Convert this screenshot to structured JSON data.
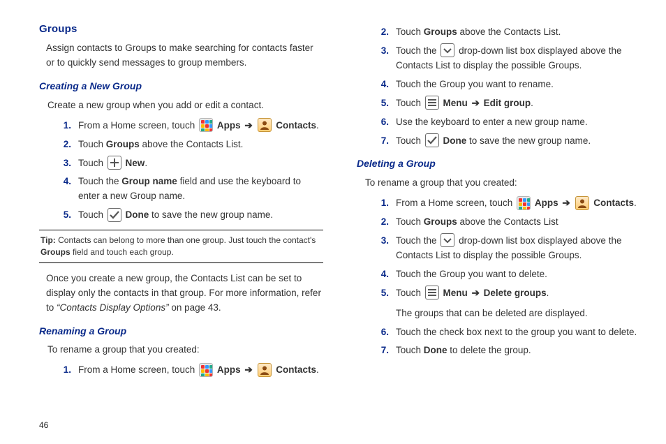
{
  "pageNumber": "46",
  "left": {
    "h1": "Groups",
    "intro": "Assign contacts to Groups to make searching for contacts faster or to quickly send messages to group members.",
    "h2a": "Creating a New Group",
    "createIntro": "Create a new group when you add or edit a contact.",
    "steps1": {
      "s1a": "From a Home screen, touch ",
      "s1apps": "Apps",
      "s1arrow": "➔",
      "s1contacts": "Contacts",
      "s1end": ".",
      "s2a": "Touch ",
      "s2b": "Groups",
      "s2c": " above the Contacts List.",
      "s3a": "Touch ",
      "s3b": "New",
      "s3c": ".",
      "s4a": "Touch the ",
      "s4b": "Group name",
      "s4c": " field",
      "s4d": " and use the keyboard to enter a new Group name.",
      "s5a": "Touch ",
      "s5b": "Done",
      "s5c": " to save the new group name."
    },
    "tip": {
      "label": "Tip:",
      "textA": " Contacts can belong to more than one group. Just touch the contact's ",
      "bold": "Groups",
      "textB": " field and touch each group."
    },
    "afterTip": {
      "lineA": "Once you create a new group, the Contacts List can be set to display only the contacts in that group. For more information, refer to ",
      "ref": "“Contacts Display Options”",
      "lineB": "  on page 43."
    },
    "h2b": "Renaming a Group",
    "renameIntro": "To rename a group that you created:",
    "steps2": {
      "s1a": "From a Home screen, touch ",
      "s1apps": "Apps",
      "s1arrow": "➔",
      "s1contacts": "Contacts",
      "s1end": "."
    }
  },
  "right": {
    "steps2cont": {
      "s2a": "Touch ",
      "s2b": "Groups",
      "s2c": " above the Contacts List.",
      "s3a": "Touch the ",
      "s3b": " drop-down list box displayed above the Contacts List to display the possible Groups.",
      "s4": "Touch the Group you want to rename.",
      "s5a": "Touch ",
      "s5b": "Menu",
      "s5arrow": "➔",
      "s5c": "Edit group",
      "s5end": ".",
      "s6": "Use the keyboard to enter a new group name.",
      "s7a": "Touch ",
      "s7b": "Done",
      "s7c": " to save the new group name."
    },
    "h2c": "Deleting a Group",
    "delIntro": "To rename a group that you created:",
    "steps3": {
      "s1a": "From a Home screen, touch ",
      "s1apps": "Apps",
      "s1arrow": "➔",
      "s1contacts": "Contacts",
      "s1end": ".",
      "s2a": "Touch ",
      "s2b": "Groups",
      "s2c": " above the Contacts List",
      "s3a": "Touch the ",
      "s3b": " drop-down list box displayed above the Contacts List to display the possible Groups.",
      "s4": "Touch the Group you want to delete.",
      "s5a": "Touch ",
      "s5b": "Menu",
      "s5arrow": "➔",
      "s5c": "Delete groups",
      "s5end": ".",
      "s5note": "The groups that can be deleted are displayed.",
      "s6": "Touch the check box next to the group you want to delete.",
      "s7a": "Touch ",
      "s7b": "Done",
      "s7c": " to delete the group."
    }
  }
}
